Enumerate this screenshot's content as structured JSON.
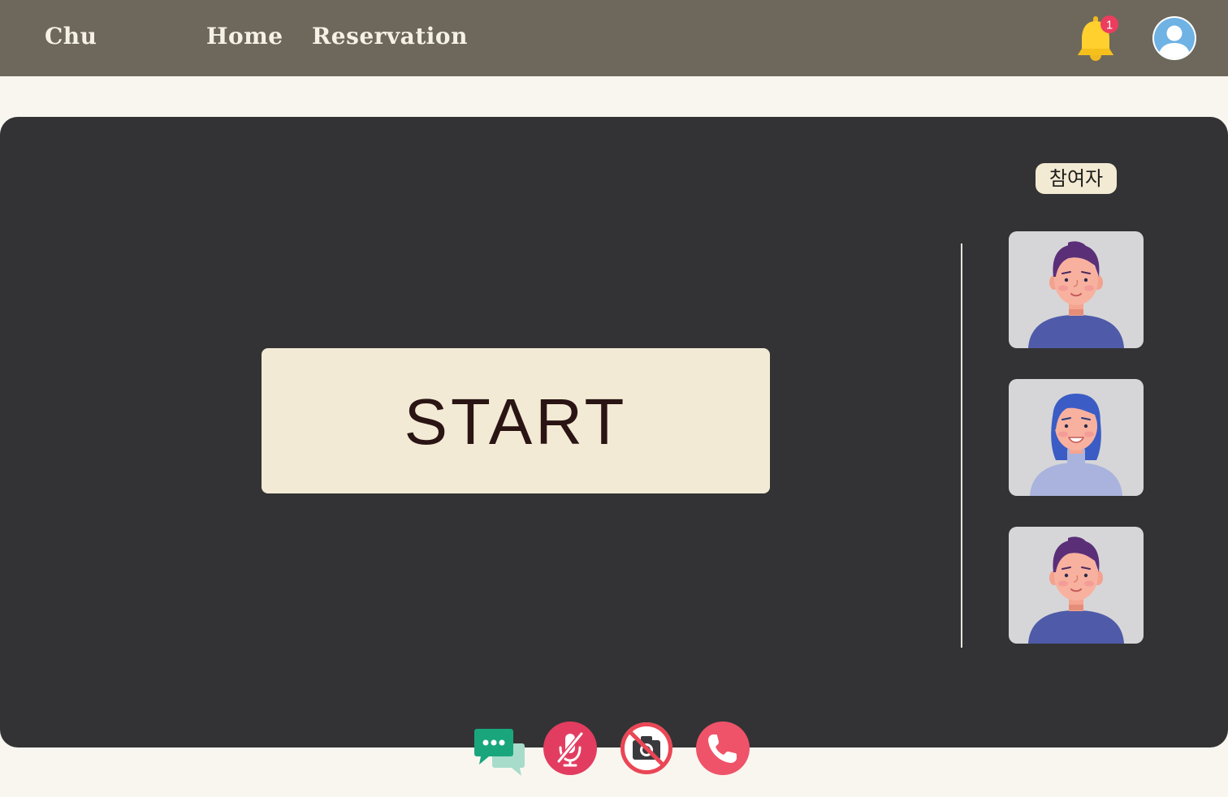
{
  "header": {
    "brand": "Chu",
    "nav": [
      {
        "label": "Home"
      },
      {
        "label": "Reservation"
      }
    ],
    "notifications": {
      "icon": "bell-icon",
      "count": "1"
    },
    "profile": {
      "icon": "user-avatar-icon"
    }
  },
  "call": {
    "start_label": "START",
    "participants_label": "참여자",
    "participants": [
      {
        "avatar": "male-avatar"
      },
      {
        "avatar": "female-avatar"
      },
      {
        "avatar": "male-avatar"
      }
    ]
  },
  "controls": [
    {
      "name": "chat",
      "icon": "chat-bubbles-icon"
    },
    {
      "name": "mic-off",
      "icon": "mic-off-icon"
    },
    {
      "name": "camera-off",
      "icon": "camera-off-icon"
    },
    {
      "name": "hang-up",
      "icon": "phone-icon"
    }
  ],
  "colors": {
    "header_bg": "#6e685c",
    "page_bg": "#f9f6f0",
    "stage_bg": "#333335",
    "start_bg": "#f2ead4",
    "danger": "#e34a62",
    "chat_green": "#1aa67d"
  }
}
